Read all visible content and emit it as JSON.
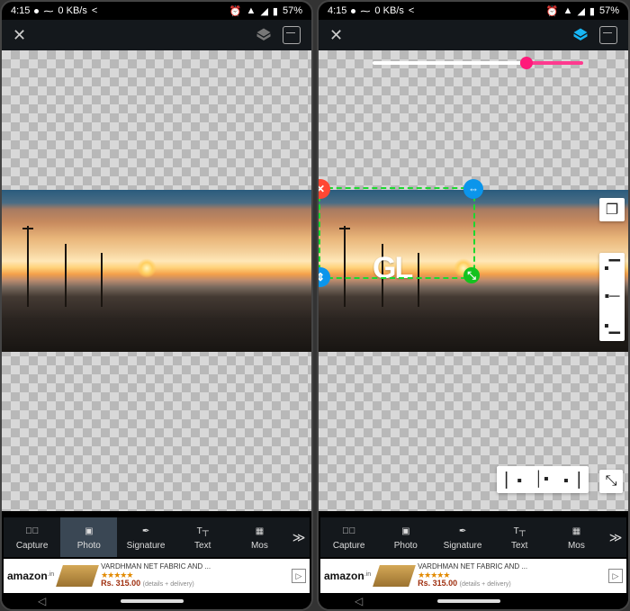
{
  "status": {
    "time": "4:15",
    "net": "KB/s",
    "net_val": "0",
    "battery": "57%"
  },
  "toolbar": {
    "close": "✕"
  },
  "slider": {
    "value": 70
  },
  "watermark": "GL",
  "tools": [
    {
      "id": "capture",
      "label": "Capture"
    },
    {
      "id": "photo",
      "label": "Photo"
    },
    {
      "id": "signature",
      "label": "Signature"
    },
    {
      "id": "text",
      "label": "Text"
    },
    {
      "id": "mosaic",
      "label": "Mos"
    }
  ],
  "ad": {
    "brand": "amazon",
    "brand_suffix": ".in",
    "title": "VARDHMAN NET FABRIC AND ...",
    "stars": "★★★★★",
    "price": "Rs. 315.00",
    "details": "(details + delivery)"
  }
}
